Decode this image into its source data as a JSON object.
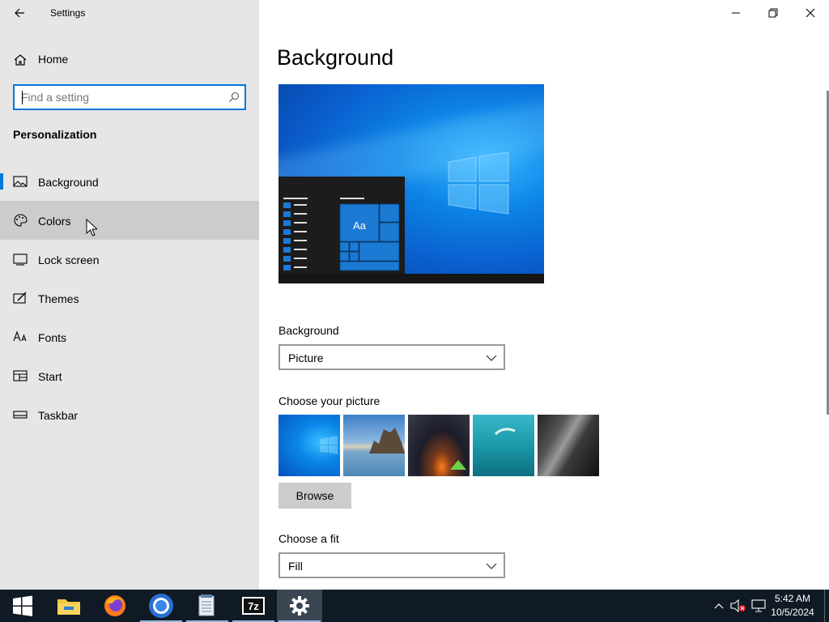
{
  "window": {
    "title": "Settings"
  },
  "sidebar": {
    "home_label": "Home",
    "search_placeholder": "Find a setting",
    "section_title": "Personalization",
    "items": [
      {
        "label": "Background",
        "icon": "picture-icon"
      },
      {
        "label": "Colors",
        "icon": "palette-icon"
      },
      {
        "label": "Lock screen",
        "icon": "lock-screen-icon"
      },
      {
        "label": "Themes",
        "icon": "themes-icon"
      },
      {
        "label": "Fonts",
        "icon": "fonts-icon"
      },
      {
        "label": "Start",
        "icon": "start-icon"
      },
      {
        "label": "Taskbar",
        "icon": "taskbar-icon"
      }
    ],
    "selected_item": "Background",
    "hovered_item": "Colors"
  },
  "main": {
    "page_title": "Background",
    "preview_tile_text": "Aa",
    "background_label": "Background",
    "background_value": "Picture",
    "choose_picture_label": "Choose your picture",
    "browse_label": "Browse",
    "choose_fit_label": "Choose a fit",
    "fit_value": "Fill"
  },
  "taskbar": {
    "apps": [
      "Start",
      "File Explorer",
      "Firefox",
      "Chrome",
      "Notepad",
      "7-Zip",
      "Settings"
    ],
    "active_app": "Settings",
    "time": "5:42 AM",
    "date": "10/5/2024"
  },
  "colors": {
    "accent": "#0078d7",
    "sidebar_bg": "#e6e6e6",
    "taskbar_bg": "#101a24"
  }
}
